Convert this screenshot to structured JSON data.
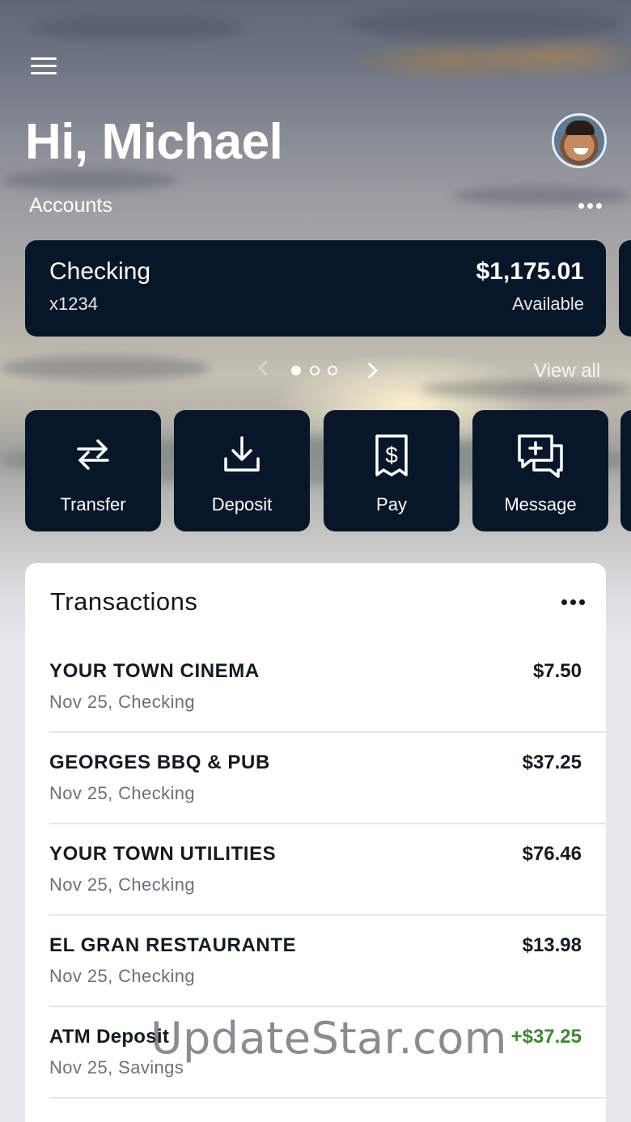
{
  "header": {
    "greeting": "Hi, Michael"
  },
  "accounts": {
    "label": "Accounts",
    "card": {
      "name": "Checking",
      "number": "x1234",
      "balance": "$1,175.01",
      "balance_label": "Available"
    },
    "pager": {
      "total_pages": 3,
      "current_page": 1
    },
    "view_all": "View all"
  },
  "actions": [
    {
      "label": "Transfer",
      "icon": "transfer-icon"
    },
    {
      "label": "Deposit",
      "icon": "deposit-icon"
    },
    {
      "label": "Pay",
      "icon": "pay-icon"
    },
    {
      "label": "Message",
      "icon": "message-icon"
    }
  ],
  "transactions": {
    "title": "Transactions",
    "items": [
      {
        "name": "YOUR TOWN CINEMA",
        "sub": "Nov 25, Checking",
        "amount": "$7.50",
        "credit": false
      },
      {
        "name": "GEORGES BBQ & PUB",
        "sub": "Nov 25, Checking",
        "amount": "$37.25",
        "credit": false
      },
      {
        "name": "YOUR TOWN UTILITIES",
        "sub": "Nov 25, Checking",
        "amount": "$76.46",
        "credit": false
      },
      {
        "name": "EL GRAN RESTAURANTE",
        "sub": "Nov 25, Checking",
        "amount": "$13.98",
        "credit": false
      },
      {
        "name": "ATM Deposit",
        "sub": "Nov 25, Savings",
        "amount": "+$37.25",
        "credit": true
      }
    ]
  },
  "watermark": "UpdateStar.com",
  "colors": {
    "card_bg": "#08162a",
    "credit_green": "#3b8a2e",
    "text_dark": "#141a22"
  }
}
